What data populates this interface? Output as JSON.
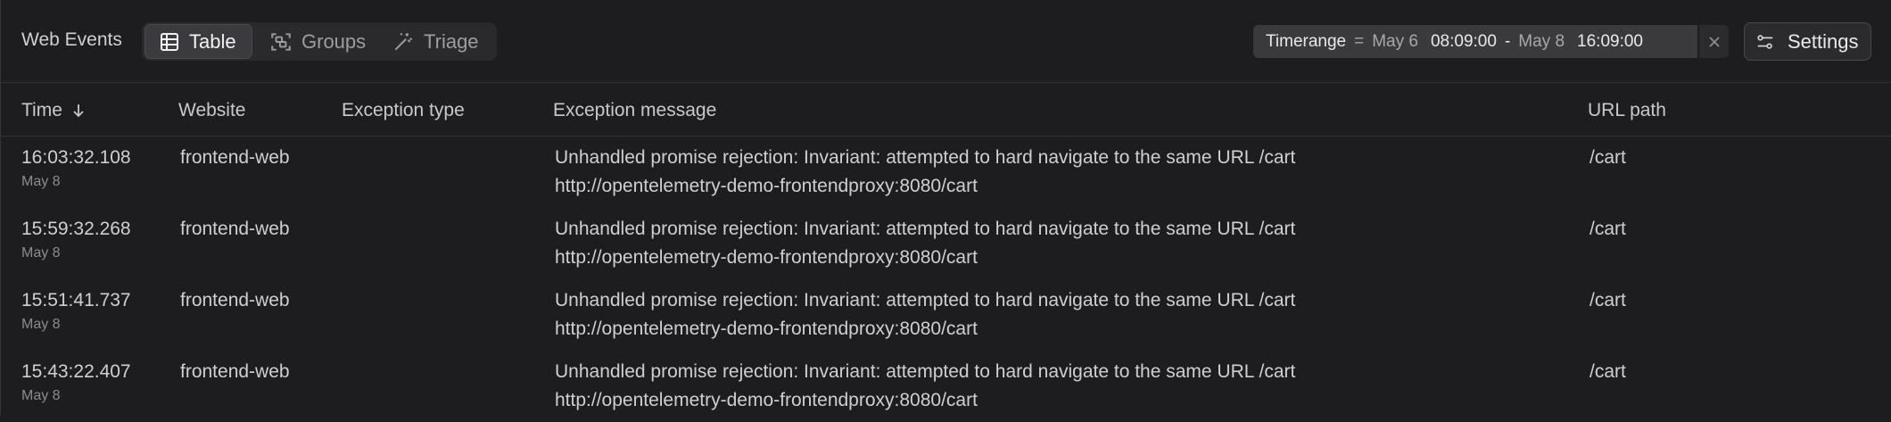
{
  "toolbar": {
    "title": "Web Events",
    "tabs": [
      {
        "label": "Table",
        "icon": "table-icon",
        "active": true
      },
      {
        "label": "Groups",
        "icon": "groups-icon",
        "active": false
      },
      {
        "label": "Triage",
        "icon": "triage-wand-icon",
        "active": false
      }
    ],
    "filter": {
      "key": "Timerange",
      "op": "=",
      "start_date": "May 6",
      "start_time": "08:09:00",
      "sep": "-",
      "end_date": "May 8",
      "end_time": "16:09:00",
      "close_icon": "close-icon"
    },
    "settings_label": "Settings"
  },
  "table": {
    "columns": [
      "Time",
      "Website",
      "Exception type",
      "Exception message",
      "URL path"
    ],
    "sort_icon": "arrow-down-icon",
    "rows": [
      {
        "time": "16:03:32.108",
        "date": "May 8",
        "website": "frontend-web",
        "exception_type": "",
        "message_line1": "Unhandled promise rejection: Invariant: attempted to hard navigate to the same URL /cart",
        "message_line2": "http://opentelemetry-demo-frontendproxy:8080/cart",
        "url_path": "/cart"
      },
      {
        "time": "15:59:32.268",
        "date": "May 8",
        "website": "frontend-web",
        "exception_type": "",
        "message_line1": "Unhandled promise rejection: Invariant: attempted to hard navigate to the same URL /cart",
        "message_line2": "http://opentelemetry-demo-frontendproxy:8080/cart",
        "url_path": "/cart"
      },
      {
        "time": "15:51:41.737",
        "date": "May 8",
        "website": "frontend-web",
        "exception_type": "",
        "message_line1": "Unhandled promise rejection: Invariant: attempted to hard navigate to the same URL /cart",
        "message_line2": "http://opentelemetry-demo-frontendproxy:8080/cart",
        "url_path": "/cart"
      },
      {
        "time": "15:43:22.407",
        "date": "May 8",
        "website": "frontend-web",
        "exception_type": "",
        "message_line1": "Unhandled promise rejection: Invariant: attempted to hard navigate to the same URL /cart",
        "message_line2": "http://opentelemetry-demo-frontendproxy:8080/cart",
        "url_path": "/cart"
      }
    ]
  }
}
